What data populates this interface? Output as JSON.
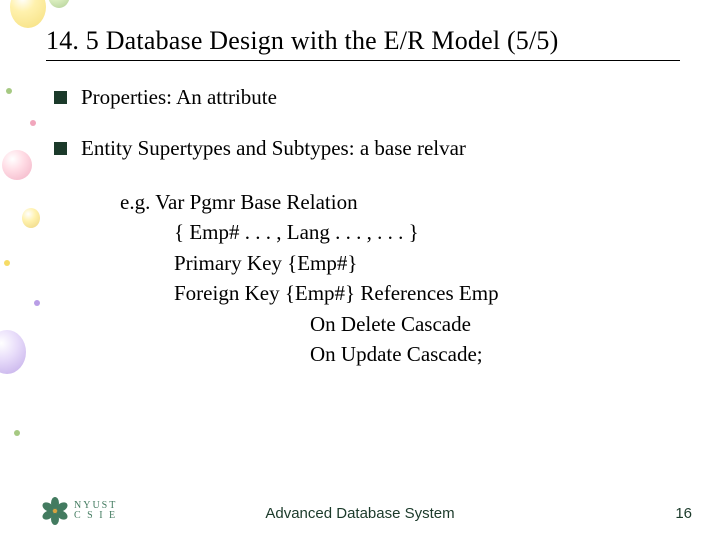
{
  "title": "14. 5   Database Design with the E/R Model (5/5)",
  "bullets": [
    "Properties: An attribute",
    "Entity Supertypes and Subtypes: a base relvar"
  ],
  "example": {
    "l0": "e.g. Var Pgmr Base Relation",
    "l1": "{ Emp# . . . , Lang . . . , . . . }",
    "l2": "Primary Key {Emp#}",
    "l3": "Foreign Key {Emp#} References Emp",
    "l4": "On Delete Cascade",
    "l5": "On Update Cascade;"
  },
  "logo": {
    "line1": "NYUST",
    "line2": "C S I E"
  },
  "footer_center": "Advanced Database System",
  "page_number": "16"
}
